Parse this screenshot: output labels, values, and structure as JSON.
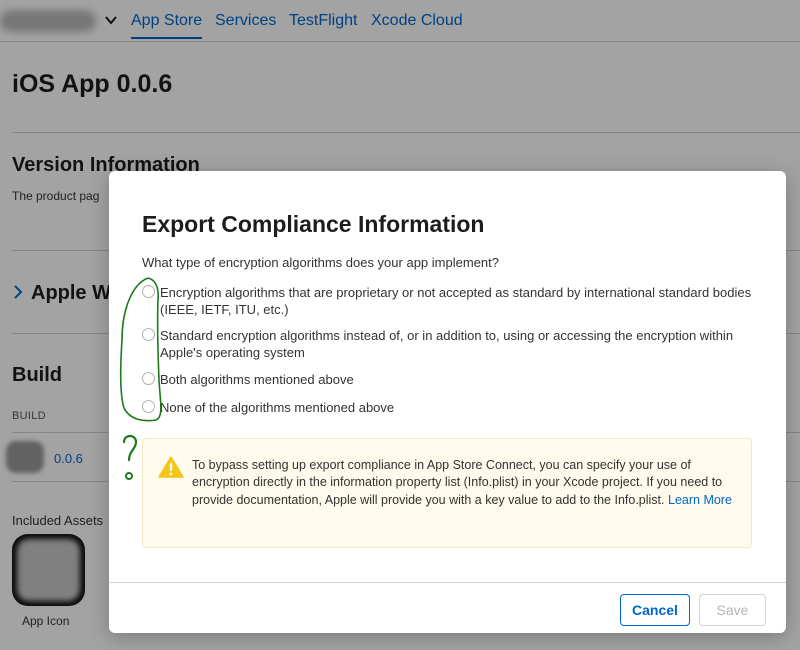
{
  "nav": {
    "tabs": [
      "App Store",
      "Services",
      "TestFlight",
      "Xcode Cloud"
    ]
  },
  "page": {
    "title": "iOS App 0.0.6",
    "version_section_title": "Version Information",
    "version_section_desc": "The product pag",
    "apple_section_title": "Apple W",
    "build_section_title": "Build",
    "build_column_header": "BUILD",
    "build_version": "0.0.6",
    "included_assets_label": "Included Assets",
    "app_icon_label": "App Icon"
  },
  "modal": {
    "title": "Export Compliance Information",
    "question": "What type of encryption algorithms does your app implement?",
    "options": [
      "Encryption algorithms that are proprietary or not accepted as standard by international standard bodies (IEEE, IETF, ITU, etc.)",
      "Standard encryption algorithms instead of, or in addition to, using or accessing the encryption within Apple's operating system",
      "Both algorithms mentioned above",
      "None of the algorithms mentioned above"
    ],
    "notice_text": "To bypass setting up export compliance in App Store Connect, you can specify your use of encryption directly in the information property list (Info.plist) in your Xcode project. If you need to provide documentation, Apple will provide you with a key value to add to the Info.plist.",
    "notice_link": "Learn More",
    "cancel_label": "Cancel",
    "save_label": "Save"
  },
  "colors": {
    "accent": "#0066cc",
    "warning": "#f5c518",
    "annotation": "#1f7a1f"
  }
}
